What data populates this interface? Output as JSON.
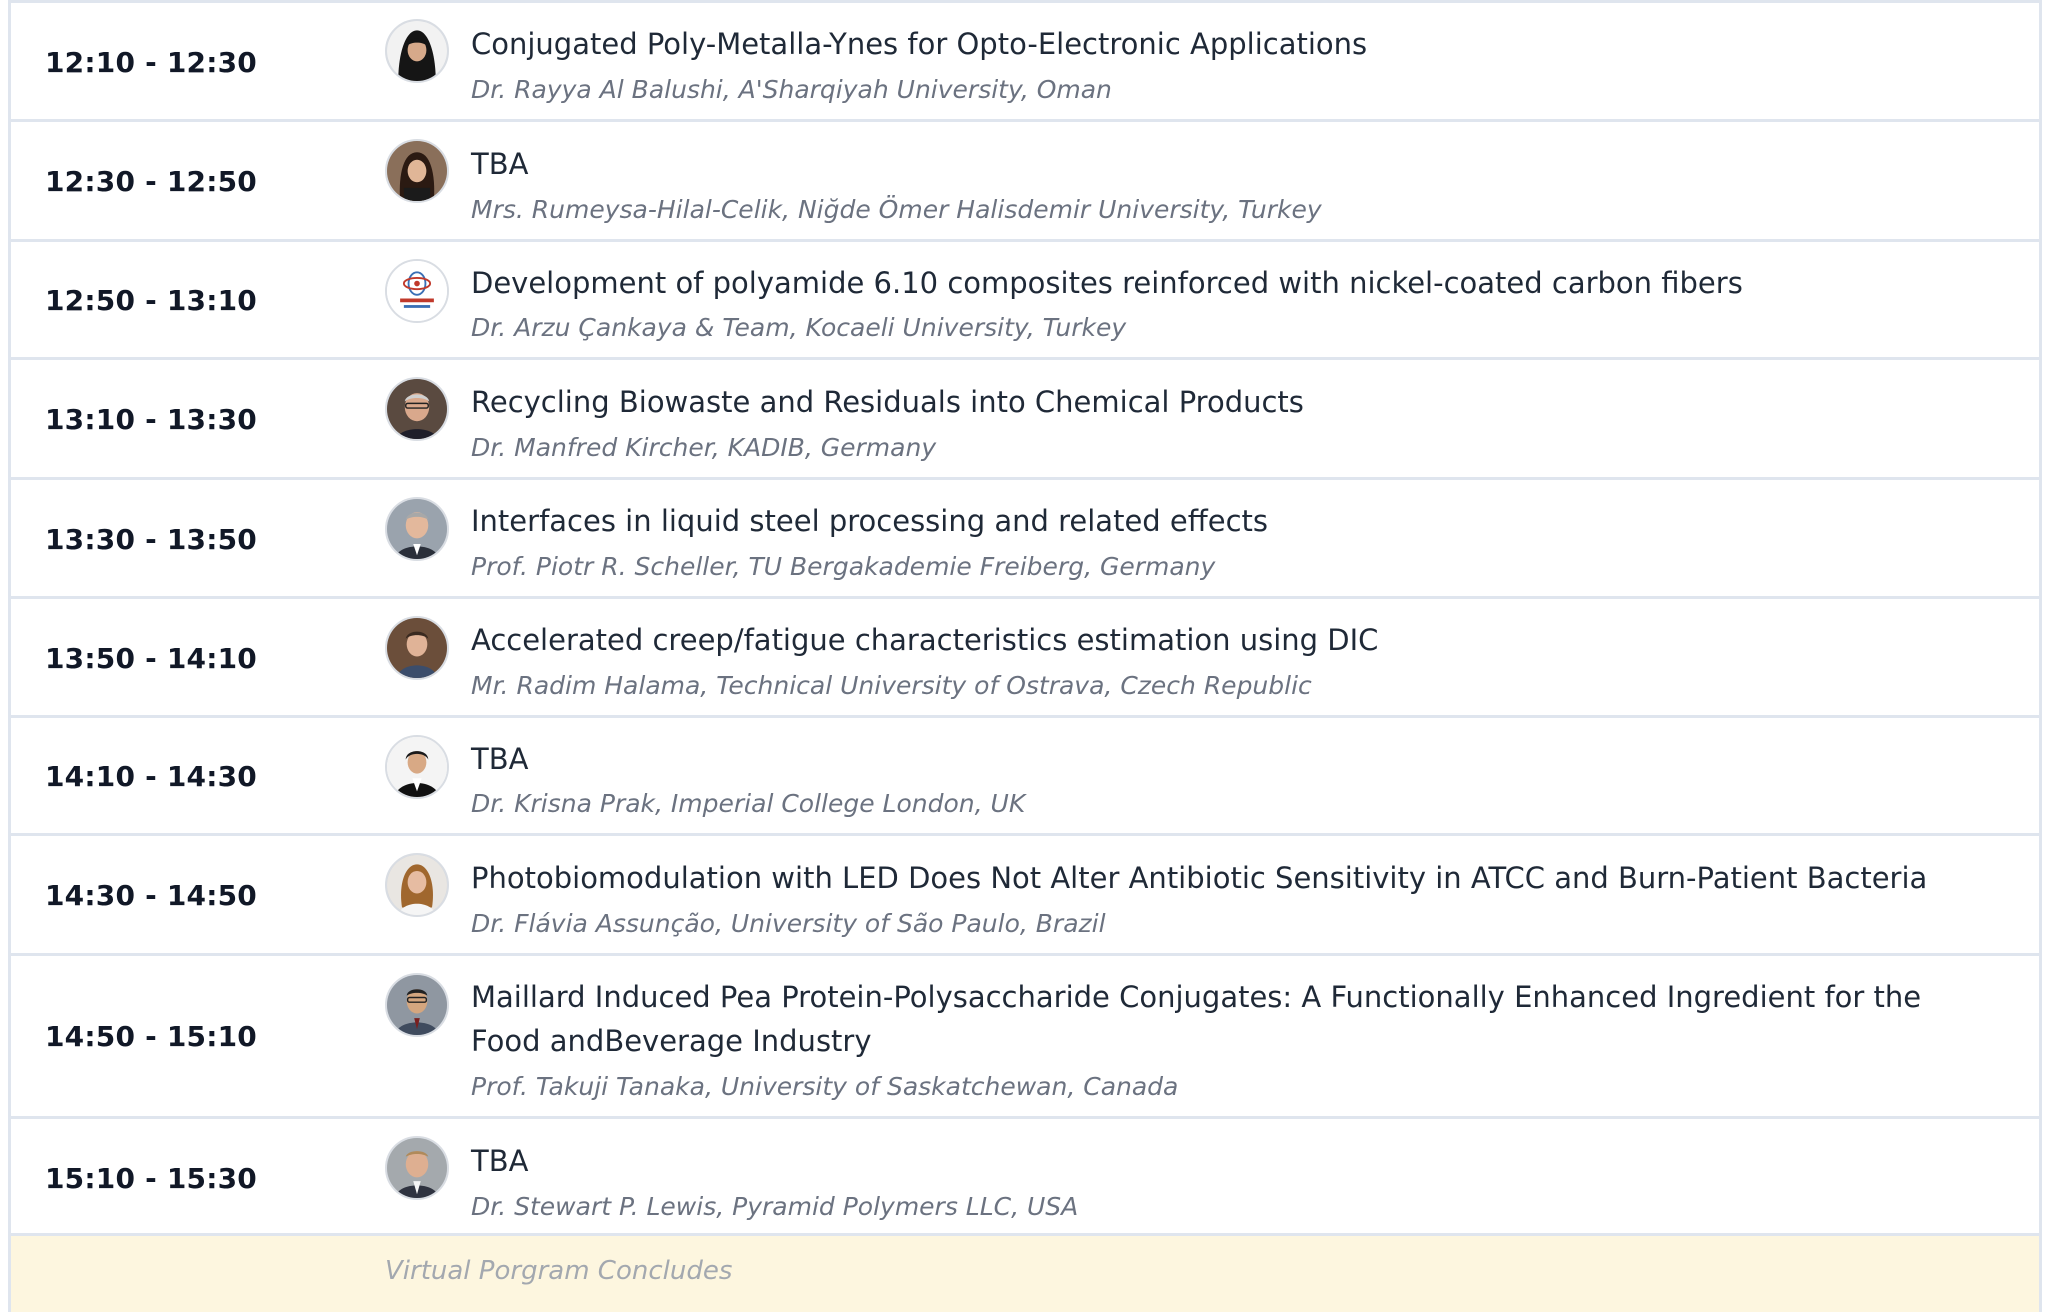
{
  "sessions": [
    {
      "time": "12:10 - 12:30",
      "title": "Conjugated Poly-Metalla-Ynes for Opto-Electronic Applications",
      "speaker": "Dr. Rayya Al Balushi, A'Sharqiyah University, Oman",
      "avatar_icon": "speaker-photo-icon"
    },
    {
      "time": "12:30 - 12:50",
      "title": "TBA",
      "speaker": "Mrs. Rumeysa-Hilal-Celik, Niğde Ömer Halisdemir University, Turkey",
      "avatar_icon": "speaker-photo-icon"
    },
    {
      "time": "12:50 - 13:10",
      "title": "Development of polyamide 6.10 composites reinforced with nickel-coated carbon fibers",
      "speaker": "Dr. Arzu Çankaya & Team, Kocaeli University, Turkey",
      "avatar_icon": "university-logo-icon"
    },
    {
      "time": "13:10 - 13:30",
      "title": "Recycling Biowaste and Residuals into Chemical Products",
      "speaker": "Dr. Manfred Kircher, KADIB, Germany",
      "avatar_icon": "speaker-photo-icon"
    },
    {
      "time": "13:30 - 13:50",
      "title": "Interfaces in liquid steel processing and related effects",
      "speaker": "Prof. Piotr R. Scheller, TU Bergakademie Freiberg, Germany",
      "avatar_icon": "speaker-photo-icon"
    },
    {
      "time": "13:50 - 14:10",
      "title": "Accelerated creep/fatigue characteristics estimation using DIC",
      "speaker": "Mr. Radim Halama, Technical University of Ostrava, Czech Republic",
      "avatar_icon": "speaker-photo-icon"
    },
    {
      "time": "14:10 - 14:30",
      "title": "TBA",
      "speaker": "Dr. Krisna Prak, Imperial College London, UK",
      "avatar_icon": "speaker-photo-icon"
    },
    {
      "time": "14:30 - 14:50",
      "title": "Photobiomodulation with LED Does Not Alter Antibiotic Sensitivity in ATCC and Burn-Patient Bacteria",
      "speaker": "Dr. Flávia Assunção, University of São Paulo, Brazil",
      "avatar_icon": "speaker-photo-icon"
    },
    {
      "time": "14:50 - 15:10",
      "title": "Maillard Induced Pea Protein-Polysaccharide Conjugates: A Functionally Enhanced Ingredient for the Food andBeverage Industry",
      "speaker": "Prof. Takuji Tanaka, University of Saskatchewan, Canada",
      "avatar_icon": "speaker-photo-icon"
    },
    {
      "time": "15:10 - 15:30",
      "title": "TBA",
      "speaker": "Dr. Stewart P. Lewis, Pyramid Polymers LLC, USA",
      "avatar_icon": "speaker-photo-icon"
    }
  ],
  "footer": {
    "text": "Virtual Porgram Concludes"
  },
  "colors": {
    "row_border": "#dfe5ee",
    "time_text": "#111827",
    "title_text": "#1f2937",
    "speaker_text": "#6b7280",
    "footer_background": "#fdf6df",
    "footer_text": "#a3a8af"
  }
}
